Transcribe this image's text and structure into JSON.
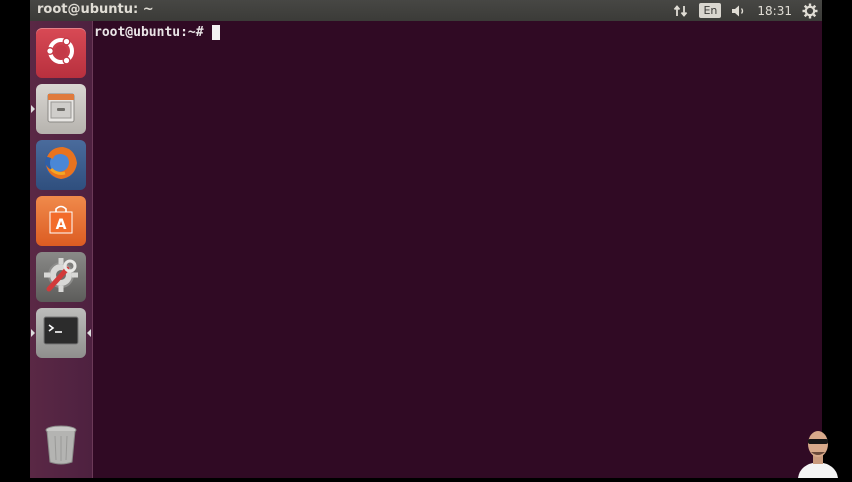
{
  "top_panel": {
    "window_title": "root@ubuntu: ~",
    "indicators": {
      "network_icon": "network-updown-icon",
      "keyboard_language": "En",
      "sound_icon": "speaker-icon",
      "time": "18:31",
      "settings_icon": "gear-icon"
    }
  },
  "launcher": {
    "items": [
      {
        "name": "dash-home",
        "icon": "ubuntu-logo-icon"
      },
      {
        "name": "files",
        "icon": "file-cabinet-icon"
      },
      {
        "name": "firefox",
        "icon": "firefox-icon"
      },
      {
        "name": "software-center",
        "icon": "shopping-bag-icon"
      },
      {
        "name": "system-settings",
        "icon": "settings-wrench-icon"
      },
      {
        "name": "terminal",
        "icon": "terminal-icon"
      },
      {
        "name": "trash",
        "icon": "trash-icon"
      }
    ]
  },
  "terminal": {
    "prompt": "root@ubuntu:~# "
  },
  "colors": {
    "terminal_bg": "#300a24",
    "launcher_bg": "#5a2845",
    "panel_bg": "#3f3f3c"
  }
}
